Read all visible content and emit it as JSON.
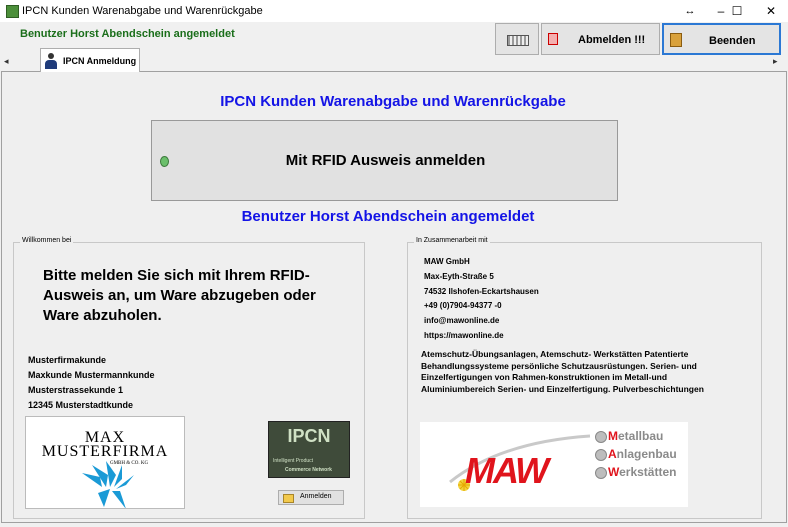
{
  "window": {
    "title": "IPCN Kunden Warenabgabe und Warenrückgabe",
    "controls": {
      "resize": "↔",
      "minimize": "–",
      "maximize": "☐",
      "close": "✕"
    }
  },
  "header": {
    "logged_in_text": "Benutzer Horst Abendschein angemeldet",
    "buttons": {
      "logout": "Abmelden !!!",
      "exit": "Beenden"
    }
  },
  "tabs": [
    {
      "label": "IPCN Anmeldung"
    }
  ],
  "tab_arrows": {
    "left": "◂",
    "right": "▸"
  },
  "main": {
    "title": "IPCN Kunden Warenabgabe und Warenrückgabe",
    "rfid_button": "Mit RFID Ausweis anmelden",
    "logged_in_text": "Benutzer Horst Abendschein angemeldet"
  },
  "welcome": {
    "legend": "Willkommen bei",
    "prompt": "Bitte melden Sie sich mit Ihrem RFID-Ausweis an, um Ware abzugeben oder Ware abzuholen.",
    "address": [
      "Musterfirmakunde",
      "Maxkunde Mustermannkunde",
      "Musterstrassekunde 1",
      "12345 Musterstadtkunde"
    ],
    "company_logo": {
      "line1": "MAX",
      "line2": "MUSTERFIRMA",
      "line3": "GMBH & CO. KG"
    },
    "ipcn_logo": {
      "name": "IPCN",
      "tag1": "Intelligent Product",
      "tag2": "Commerce Network"
    },
    "ipcn_login_button": "Anmelden"
  },
  "partner": {
    "legend": "In Zusammenarbeit mit",
    "contact": [
      "MAW GmbH",
      "Max-Eyth-Straße 5",
      "74532 Ilshofen-Eckartshausen",
      "+49 (0)7904-94377 -0",
      "info@mawonline.de",
      "https://mawonline.de"
    ],
    "description": "Atemschutz-Übungsanlagen, Atemschutz- Werkstätten Patentierte Behandlungssysteme persönliche Schutzausrüstungen. Serien- und Einzelfertigungen von Rahmen-konstruktionen im Metall-und Aluminiumbereich Serien- und Einzelfertigung. Pulverbeschichtungen",
    "logo": {
      "word": "MAW",
      "lines": [
        {
          "first": "M",
          "rest": "etallbau"
        },
        {
          "first": "A",
          "rest": "nlagenbau"
        },
        {
          "first": "W",
          "rest": "erkstätten"
        }
      ]
    }
  },
  "icons": [
    "app-icon",
    "keyboard-icon",
    "logout-icon",
    "exit-door-icon",
    "user-icon",
    "led-icon",
    "login-icon"
  ],
  "colors": {
    "accent_blue": "#1414e6",
    "logged_green": "#1a6e1a",
    "maw_red": "#e0141c",
    "focus_blue": "#2b78d4"
  }
}
